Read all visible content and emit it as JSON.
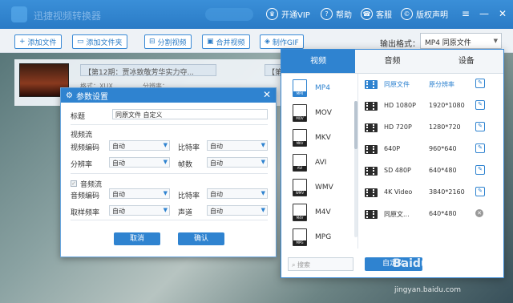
{
  "app": {
    "title": "迅捷视频转换器"
  },
  "titlebar": {
    "items": [
      {
        "icon": "crown-icon",
        "label": "开通VIP"
      },
      {
        "icon": "help-icon",
        "label": "帮助"
      },
      {
        "icon": "headset-icon",
        "label": "客服"
      },
      {
        "icon": "copyright-icon",
        "label": "版权声明"
      }
    ],
    "window_buttons": [
      "≡",
      "—",
      "✕"
    ]
  },
  "toolbar": {
    "buttons": [
      "添加文件",
      "添加文件夹",
      "分割视频",
      "合并视频",
      "制作GIF"
    ],
    "output_format_label": "输出格式：",
    "output_format_value": "MP4  同原文件"
  },
  "file_row": {
    "name": "【第12期：贾冰致敬芳华实力夺...",
    "name2": "【第",
    "meta_format": "格式：XUX",
    "meta_res": "分辨率："
  },
  "dialog": {
    "title": "参数设置",
    "title_label": "标题",
    "title_value": "同原文件 自定义",
    "video_section": "视频流",
    "audio_section": "音频流",
    "fields": {
      "video_codec": "视频编码",
      "bitrate": "比特率",
      "resolution": "分辨率",
      "fps": "帧数",
      "audio_codec": "音频编码",
      "audio_bitrate": "比特率",
      "sample_rate": "取样频率",
      "channel": "声道"
    },
    "auto": "自动",
    "cancel": "取消",
    "confirm": "确认"
  },
  "panel": {
    "tabs": [
      "视频",
      "音频",
      "设备"
    ],
    "formats": [
      "MP4",
      "MOV",
      "MKV",
      "AVI",
      "WMV",
      "M4V",
      "MPG"
    ],
    "qualities": [
      {
        "name": "同原文件",
        "res": "原分辨率",
        "action": "edit"
      },
      {
        "name": "HD 1080P",
        "res": "1920*1080",
        "action": "edit"
      },
      {
        "name": "HD 720P",
        "res": "1280*720",
        "action": "edit"
      },
      {
        "name": "640P",
        "res": "960*640",
        "action": "edit"
      },
      {
        "name": "SD 480P",
        "res": "640*480",
        "action": "edit"
      },
      {
        "name": "4K Video",
        "res": "3840*2160",
        "action": "edit"
      },
      {
        "name": "同原文...",
        "res": "640*480",
        "action": "delete"
      }
    ],
    "search_placeholder": "搜索",
    "custom_button": "自定义"
  },
  "watermark": {
    "main": "Baidu 经验",
    "sub": "jingyan.baidu.com"
  }
}
